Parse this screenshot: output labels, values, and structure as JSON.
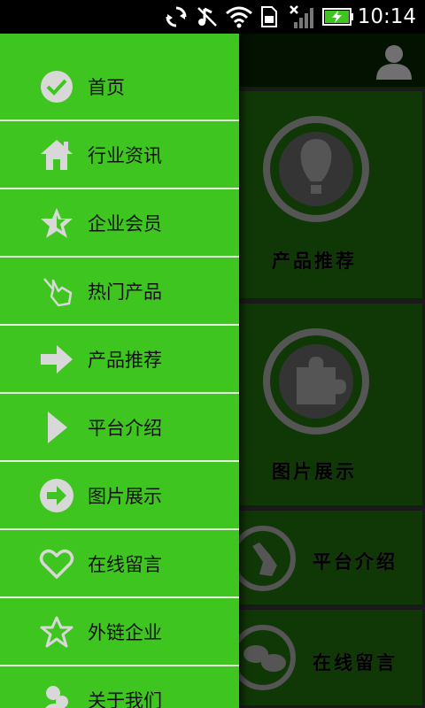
{
  "status_bar": {
    "time": "10:14",
    "icons": [
      "sync-icon",
      "music-muted-icon",
      "wifi-icon",
      "sim-icon",
      "signal-icon",
      "battery-charging-icon"
    ]
  },
  "header": {
    "profile_icon": "user-icon"
  },
  "drawer": {
    "items": [
      {
        "label": "首页",
        "icon": "check-circle-icon"
      },
      {
        "label": "行业资讯",
        "icon": "home-icon"
      },
      {
        "label": "企业会员",
        "icon": "half-star-icon"
      },
      {
        "label": "热门产品",
        "icon": "hand-pointer-icon"
      },
      {
        "label": "产品推荐",
        "icon": "arrow-right-icon"
      },
      {
        "label": "平台介绍",
        "icon": "play-triangle-icon"
      },
      {
        "label": "图片展示",
        "icon": "arrow-circle-icon"
      },
      {
        "label": "在线留言",
        "icon": "heart-icon"
      },
      {
        "label": "外链企业",
        "icon": "star-outline-icon"
      },
      {
        "label": "关于我们",
        "icon": "people-icon"
      }
    ]
  },
  "tiles": [
    {
      "label": "产品推荐",
      "icon": "balloon-icon"
    },
    {
      "label": "图片展示",
      "icon": "puzzle-icon"
    },
    {
      "label": "平台介绍",
      "icon": "hand-icon"
    },
    {
      "label": "在线留言",
      "icon": "chat-icon"
    }
  ],
  "colors": {
    "drawer_bg": "#3fc520",
    "divider": "#e6f5e0",
    "icon_gray": "#d8d8d8",
    "tile_bg": "#1b5a0b",
    "header_bg": "#061d03"
  }
}
